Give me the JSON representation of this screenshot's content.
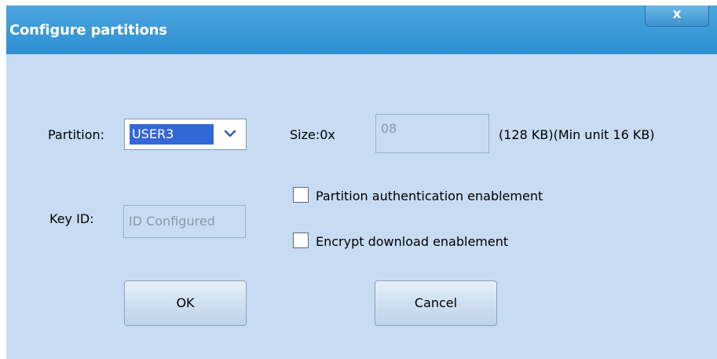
{
  "dialog": {
    "title": "Configure partitions",
    "close_label": "x"
  },
  "partition": {
    "label": "Partition:",
    "selected": "USER3"
  },
  "size": {
    "label": "Size:0x",
    "value": "08",
    "note": "(128 KB)(Min unit 16 KB)"
  },
  "key_id": {
    "label": "Key ID:",
    "value": "ID Configured"
  },
  "options": {
    "auth_label": "Partition authentication enablement",
    "auth_checked": false,
    "encrypt_label": "Encrypt download enablement",
    "encrypt_checked": false
  },
  "buttons": {
    "ok": "OK",
    "cancel": "Cancel"
  }
}
